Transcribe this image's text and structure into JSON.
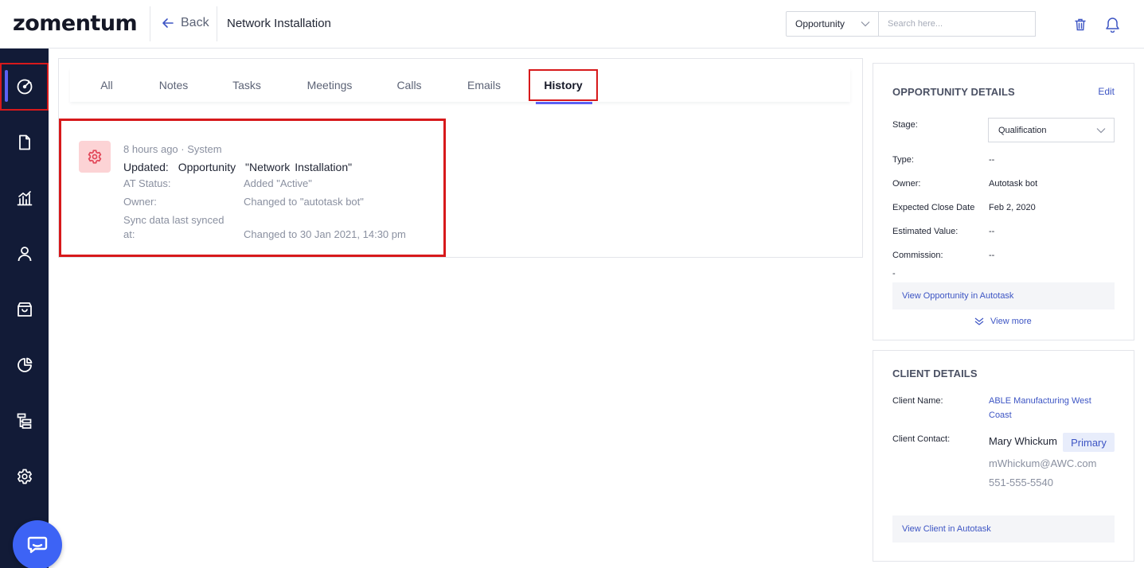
{
  "header": {
    "logo": "zomentum",
    "back_label": "Back",
    "page_title": "Network Installation",
    "entity_select": "Opportunity",
    "search_placeholder": "Search here..."
  },
  "sidebar": {
    "items": [
      {
        "icon": "opportunity-gauge-icon",
        "active": true
      },
      {
        "icon": "document-icon",
        "active": false
      },
      {
        "icon": "chart-icon",
        "active": false
      },
      {
        "icon": "person-icon",
        "active": false
      },
      {
        "icon": "bag-icon",
        "active": false
      },
      {
        "icon": "pie-chart-icon",
        "active": false
      },
      {
        "icon": "hierarchy-icon",
        "active": false
      },
      {
        "icon": "gear-icon",
        "active": false
      }
    ]
  },
  "tabs": [
    "All",
    "Notes",
    "Tasks",
    "Meetings",
    "Calls",
    "Emails",
    "History"
  ],
  "active_tab": "History",
  "history": {
    "meta": "8 hours ago · System",
    "title": {
      "action": "Updated:",
      "entity": "Opportunity",
      "name": "\"Network Installation\""
    },
    "rows": [
      {
        "label": "AT Status:",
        "value": "Added \"Active\""
      },
      {
        "label": "Owner:",
        "value": "Changed to \"autotask bot\""
      },
      {
        "label": "Sync data last synced at:",
        "value": "Changed to 30 Jan 2021, 14:30 pm"
      }
    ]
  },
  "opportunity_details": {
    "title": "OPPORTUNITY DETAILS",
    "edit": "Edit",
    "stage_label": "Stage:",
    "stage_value": "Qualification",
    "fields": [
      {
        "label": "Type:",
        "value": "--"
      },
      {
        "label": "Owner:",
        "value": "Autotask bot"
      },
      {
        "label": "Expected Close Date",
        "value": "Feb 2, 2020"
      },
      {
        "label": "Estimated Value:",
        "value": "--"
      },
      {
        "label": "Commission:",
        "value": "--"
      }
    ],
    "overflow_dash": "-",
    "view_in_autotask": "View Opportunity in Autotask",
    "view_more": "View more"
  },
  "client_details": {
    "title": "CLIENT DETAILS",
    "client_name_label": "Client Name:",
    "client_name_line1": "ABLE Manufacturing West",
    "client_name_line2": "Coast",
    "contact_label": "Client Contact:",
    "contact_name": "Mary Whickum",
    "primary_badge": "Primary",
    "contact_email": "mWhickum@AWC.com",
    "contact_phone": "551-555-5540",
    "view_in_autotask": "View Client in Autotask"
  },
  "colors": {
    "sidebar_bg": "#121b37",
    "accent": "#5b61f4",
    "link": "#3d55c4",
    "highlight_box": "#d7191b",
    "history_icon_bg": "#fcd3d5",
    "history_icon_fg": "#e2485a",
    "chat_button": "#3d63f5"
  }
}
